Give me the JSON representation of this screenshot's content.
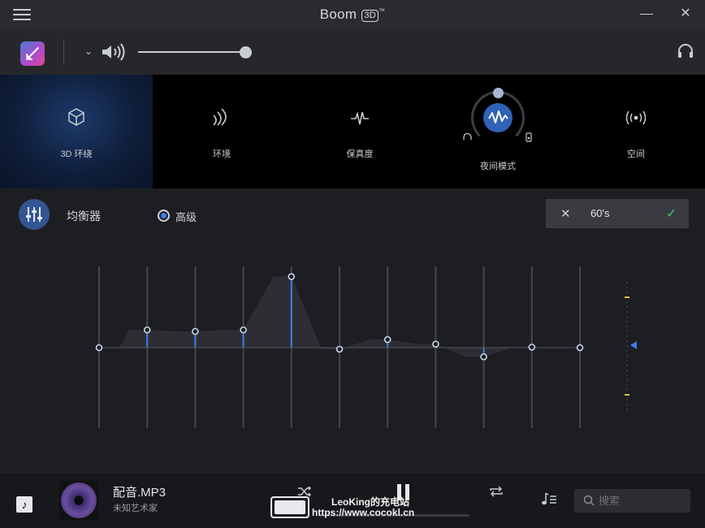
{
  "window": {
    "title_prefix": "Boom",
    "title_badge": "3D",
    "title_trademark": "™",
    "close_glyph": "✕"
  },
  "volume": {
    "level": 0.97,
    "chevron": "⌄"
  },
  "effects": [
    {
      "label": "3D 环绕",
      "active": true,
      "icon": "cube-icon"
    },
    {
      "label": "环境",
      "active": false,
      "icon": "ambience-waves-icon"
    },
    {
      "label": "保真度",
      "active": false,
      "icon": "fidelity-pulse-icon"
    },
    {
      "label": "夜间模式",
      "active": false,
      "icon": "night-mode-waveform-icon"
    },
    {
      "label": "空间",
      "active": false,
      "icon": "spatial-broadcast-icon"
    }
  ],
  "equalizer": {
    "title": "均衡器",
    "mode_label": "高级",
    "mode_selected": true,
    "preset": {
      "name": "60's",
      "cancel_glyph": "✕",
      "confirm_glyph": "✓"
    },
    "band_gains": [
      0.0,
      0.35,
      0.32,
      0.35,
      1.4,
      -0.03,
      0.16,
      0.07,
      -0.18,
      0.01,
      0.0
    ],
    "gain_range": [
      -1.6,
      1.6
    ]
  },
  "player": {
    "track_title": "配音.MP3",
    "artist": "未知艺术家",
    "progress": 0.0,
    "search_placeholder": "搜索",
    "pause_state": "playing"
  },
  "watermark": {
    "line1": "LeoKing的充电站",
    "line2": "https://www.cocokl.cn"
  },
  "colors": {
    "accent": "#3a7cf0",
    "confirm": "#3ec46d",
    "active_effect": "#1d3a6b"
  }
}
